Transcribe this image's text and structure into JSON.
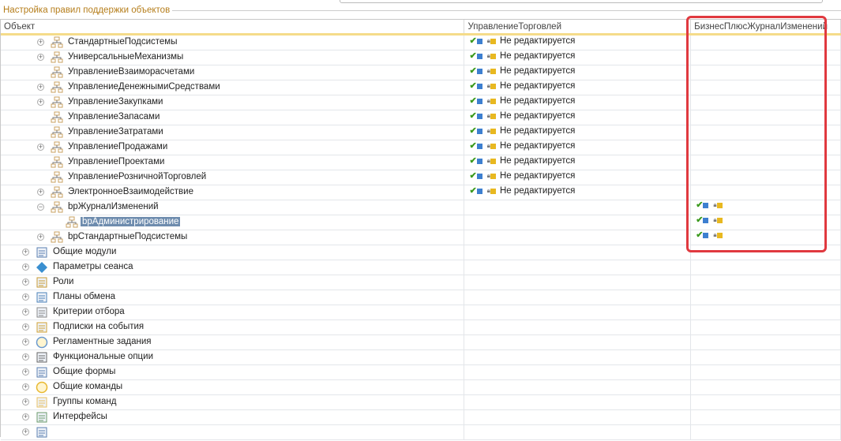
{
  "group_title": "Настройка правил поддержки объектов",
  "columns": [
    "Объект",
    "УправлениеТорговлей",
    "БизнесПлюсЖурналИзменений"
  ],
  "status_text": "Не редактируется",
  "rows": [
    {
      "label": "СтандартныеПодсистемы",
      "level": 2,
      "expander": "plus",
      "icon": "subsystem-icon",
      "col2": true,
      "col3": false
    },
    {
      "label": "УниверсальныеМеханизмы",
      "level": 2,
      "expander": "plus",
      "icon": "subsystem-icon",
      "col2": true,
      "col3": false
    },
    {
      "label": "УправлениеВзаиморасчетами",
      "level": 2,
      "expander": "none",
      "icon": "subsystem-icon",
      "col2": true,
      "col3": false
    },
    {
      "label": "УправлениеДенежнымиСредствами",
      "level": 2,
      "expander": "plus",
      "icon": "subsystem-icon",
      "col2": true,
      "col3": false
    },
    {
      "label": "УправлениеЗакупками",
      "level": 2,
      "expander": "plus",
      "icon": "subsystem-icon",
      "col2": true,
      "col3": false
    },
    {
      "label": "УправлениеЗапасами",
      "level": 2,
      "expander": "none",
      "icon": "subsystem-icon",
      "col2": true,
      "col3": false
    },
    {
      "label": "УправлениеЗатратами",
      "level": 2,
      "expander": "none",
      "icon": "subsystem-icon",
      "col2": true,
      "col3": false
    },
    {
      "label": "УправлениеПродажами",
      "level": 2,
      "expander": "plus",
      "icon": "subsystem-icon",
      "col2": true,
      "col3": false
    },
    {
      "label": "УправлениеПроектами",
      "level": 2,
      "expander": "none",
      "icon": "subsystem-icon",
      "col2": true,
      "col3": false
    },
    {
      "label": "УправлениеРозничнойТорговлей",
      "level": 2,
      "expander": "none",
      "icon": "subsystem-icon",
      "col2": true,
      "col3": false
    },
    {
      "label": "ЭлектронноеВзаимодействие",
      "level": 2,
      "expander": "plus",
      "icon": "subsystem-icon",
      "col2": true,
      "col3": false
    },
    {
      "label": "bpЖурналИзменений",
      "level": 2,
      "expander": "minus",
      "icon": "subsystem-icon",
      "col2": false,
      "col3": true
    },
    {
      "label": "bpАдминистрирование",
      "level": 3,
      "expander": "none",
      "icon": "subsystem-icon",
      "col2": false,
      "col3": true,
      "selected": true
    },
    {
      "label": "bpСтандартныеПодсистемы",
      "level": 2,
      "expander": "plus",
      "icon": "subsystem-icon",
      "col2": false,
      "col3": true
    },
    {
      "label": "Общие модули",
      "level": 1,
      "expander": "plus",
      "icon": "common-modules-icon"
    },
    {
      "label": "Параметры сеанса",
      "level": 1,
      "expander": "plus",
      "icon": "session-params-icon"
    },
    {
      "label": "Роли",
      "level": 1,
      "expander": "plus",
      "icon": "roles-icon"
    },
    {
      "label": "Планы обмена",
      "level": 1,
      "expander": "plus",
      "icon": "exchange-plans-icon"
    },
    {
      "label": "Критерии отбора",
      "level": 1,
      "expander": "plus",
      "icon": "filter-criteria-icon"
    },
    {
      "label": "Подписки на события",
      "level": 1,
      "expander": "plus",
      "icon": "event-subscriptions-icon"
    },
    {
      "label": "Регламентные задания",
      "level": 1,
      "expander": "plus",
      "icon": "scheduled-jobs-icon"
    },
    {
      "label": "Функциональные опции",
      "level": 1,
      "expander": "plus",
      "icon": "functional-options-icon"
    },
    {
      "label": "Общие формы",
      "level": 1,
      "expander": "plus",
      "icon": "common-forms-icon"
    },
    {
      "label": "Общие команды",
      "level": 1,
      "expander": "plus",
      "icon": "common-commands-icon"
    },
    {
      "label": "Группы команд",
      "level": 1,
      "expander": "plus",
      "icon": "command-groups-icon"
    },
    {
      "label": "Интерфейсы",
      "level": 1,
      "expander": "plus",
      "icon": "interfaces-icon"
    },
    {
      "label": "",
      "level": 1,
      "expander": "plus",
      "icon": "generic-icon"
    }
  ],
  "colors": {
    "accent": "#f5dc8a",
    "highlight": "#e0393f",
    "selection": "#6e8cae"
  }
}
